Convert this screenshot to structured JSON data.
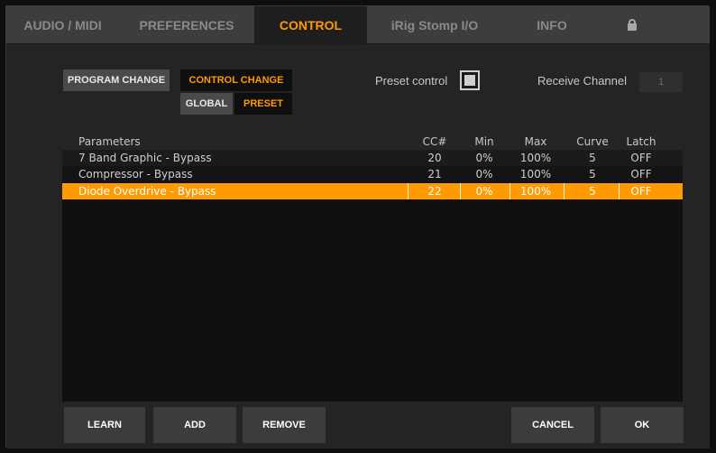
{
  "tabs": [
    {
      "label": "AUDIO / MIDI",
      "active": false
    },
    {
      "label": "PREFERENCES",
      "active": false
    },
    {
      "label": "CONTROL",
      "active": true
    },
    {
      "label": "iRig Stomp I/O",
      "active": false
    },
    {
      "label": "INFO",
      "active": false
    }
  ],
  "lock_icon": "lock-icon",
  "mode": {
    "program_change": "PROGRAM CHANGE",
    "control_change": "CONTROL CHANGE",
    "global": "GLOBAL",
    "preset": "PRESET"
  },
  "preset_control": {
    "label": "Preset control",
    "checked": true
  },
  "receive_channel": {
    "label": "Receive Channel",
    "value": "1"
  },
  "table": {
    "headers": [
      "Parameters",
      "CC#",
      "Min",
      "Max",
      "Curve",
      "Latch"
    ],
    "rows": [
      {
        "param": "7 Band Graphic - Bypass",
        "cc": "20",
        "min": "0%",
        "max": "100%",
        "curve": "5",
        "latch": "OFF",
        "selected": false
      },
      {
        "param": "Compressor - Bypass",
        "cc": "21",
        "min": "0%",
        "max": "100%",
        "curve": "5",
        "latch": "OFF",
        "selected": false
      },
      {
        "param": "Diode Overdrive - Bypass",
        "cc": "22",
        "min": "0%",
        "max": "100%",
        "curve": "5",
        "latch": "OFF",
        "selected": true
      }
    ]
  },
  "buttons": {
    "learn": "LEARN",
    "add": "ADD",
    "remove": "REMOVE",
    "cancel": "CANCEL",
    "ok": "OK"
  },
  "colors": {
    "accent": "#ff9a00",
    "background": "#242424",
    "table_bg": "#101010"
  }
}
